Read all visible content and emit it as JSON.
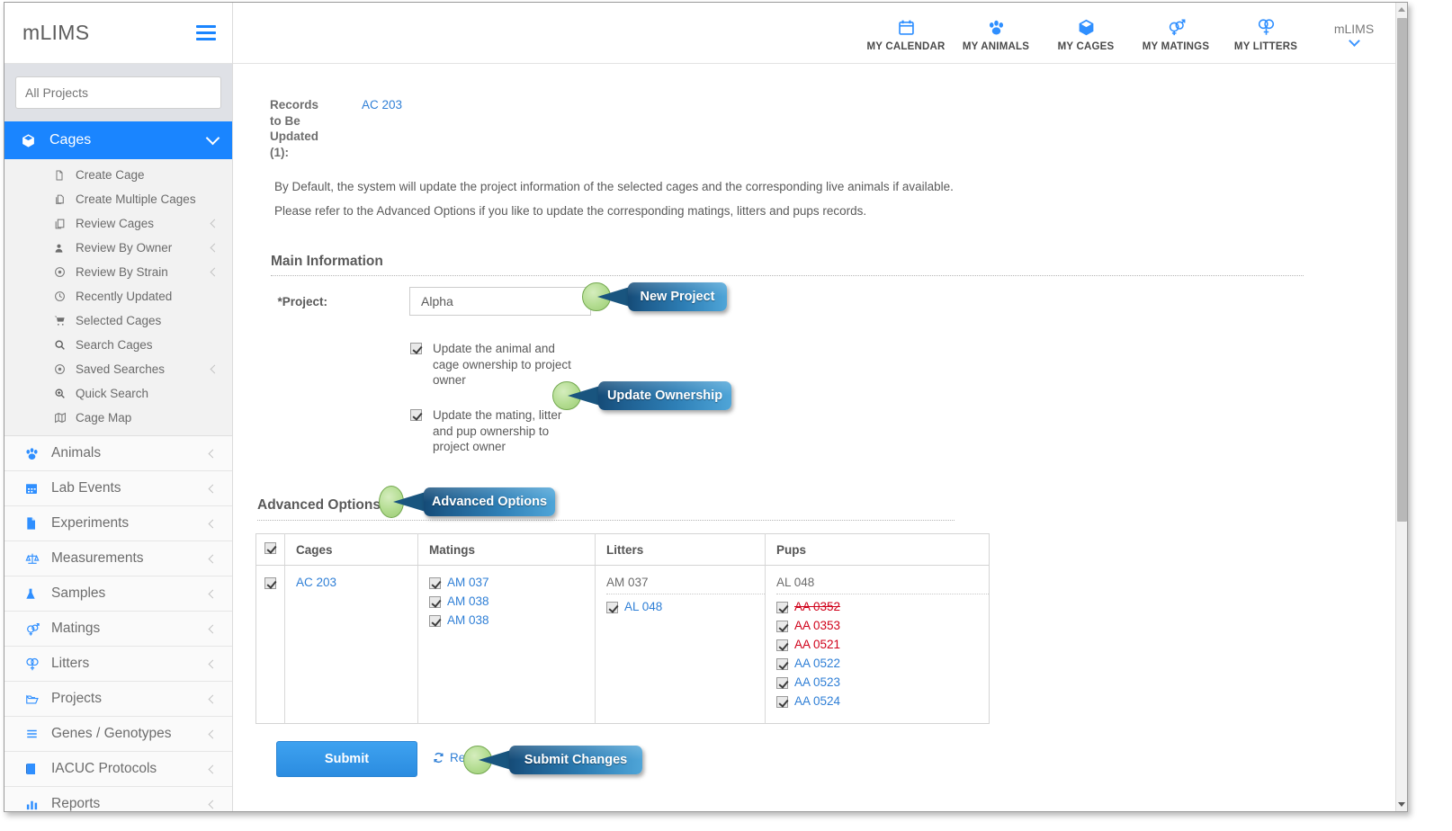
{
  "brand": {
    "name": "mLIMS",
    "menu_icon": "hamburger-icon"
  },
  "sidebar": {
    "project_filter_placeholder": "All Projects",
    "project_filter_value": "",
    "active_group": {
      "label": "Cages",
      "icon": "cube-icon",
      "expanded": true
    },
    "sub_items": [
      {
        "label": "Create Cage",
        "icon": "file-icon",
        "has_chevron": false
      },
      {
        "label": "Create Multiple Cages",
        "icon": "copy-files-icon",
        "has_chevron": false
      },
      {
        "label": "Review Cages",
        "icon": "copy-icon",
        "has_chevron": true
      },
      {
        "label": "Review By Owner",
        "icon": "user-icon",
        "has_chevron": true
      },
      {
        "label": "Review By Strain",
        "icon": "target-icon",
        "has_chevron": true
      },
      {
        "label": "Recently Updated",
        "icon": "clock-icon",
        "has_chevron": false
      },
      {
        "label": "Selected Cages",
        "icon": "cart-icon",
        "has_chevron": false
      },
      {
        "label": "Search Cages",
        "icon": "search-icon",
        "has_chevron": false
      },
      {
        "label": "Saved Searches",
        "icon": "target-icon",
        "has_chevron": true
      },
      {
        "label": "Quick Search",
        "icon": "search-plus-icon",
        "has_chevron": false
      },
      {
        "label": "Cage Map",
        "icon": "map-icon",
        "has_chevron": false
      }
    ],
    "main_items": [
      {
        "label": "Animals",
        "icon": "paw-icon"
      },
      {
        "label": "Lab Events",
        "icon": "calendar-icon"
      },
      {
        "label": "Experiments",
        "icon": "flask-doc-icon"
      },
      {
        "label": "Measurements",
        "icon": "scale-icon"
      },
      {
        "label": "Samples",
        "icon": "flask-icon"
      },
      {
        "label": "Matings",
        "icon": "male-female-icon"
      },
      {
        "label": "Litters",
        "icon": "double-female-icon"
      },
      {
        "label": "Projects",
        "icon": "folder-icon"
      },
      {
        "label": "Genes / Genotypes",
        "icon": "list-icon"
      },
      {
        "label": "IACUC Protocols",
        "icon": "book-icon"
      },
      {
        "label": "Reports",
        "icon": "chart-icon"
      }
    ]
  },
  "topnav": {
    "items": [
      {
        "label": "MY CALENDAR",
        "icon": "calendar-icon"
      },
      {
        "label": "MY ANIMALS",
        "icon": "paw-icon"
      },
      {
        "label": "MY CAGES",
        "icon": "cube-icon"
      },
      {
        "label": "MY MATINGS",
        "icon": "male-female-icon"
      },
      {
        "label": "MY LITTERS",
        "icon": "double-female-icon"
      }
    ],
    "user": {
      "name": "mLIMS",
      "caret": "chevron-down-icon"
    }
  },
  "page": {
    "records_heading": "Records to Be Updated (1):",
    "records_link": "AC 203",
    "description_line1": "By Default, the system will update the project information of the selected cages and the corresponding live animals if available.",
    "description_line2": "Please refer to the Advanced Options if you like to update the corresponding matings, litters and pups records."
  },
  "main_information": {
    "section_title": "Main Information",
    "project_label": "*Project:",
    "project_value": "Alpha",
    "checkboxes": [
      {
        "label": "Update the animal and cage ownership to project owner",
        "checked": true
      },
      {
        "label": "Update the mating, litter and pup ownership to project owner",
        "checked": true
      }
    ]
  },
  "advanced_options": {
    "section_title": "Advanced Options",
    "table": {
      "select_all_checked": true,
      "columns": [
        "",
        "Cages",
        "Matings",
        "Litters",
        "Pups"
      ],
      "row": {
        "row_checked": true,
        "cages": [
          {
            "text": "AC 203",
            "style": "link",
            "checkbox": false
          }
        ],
        "matings": [
          {
            "text": "AM 037",
            "style": "link",
            "checkbox": true,
            "checked": true
          },
          {
            "text": "AM 038",
            "style": "link",
            "checkbox": true,
            "checked": true
          },
          {
            "text": "AM 038",
            "style": "link",
            "checkbox": true,
            "checked": true
          }
        ],
        "litters": [
          {
            "text": "AM 037",
            "style": "plain-header",
            "checkbox": false
          },
          {
            "text": "AL 048",
            "style": "link",
            "checkbox": true,
            "checked": true
          }
        ],
        "pups": [
          {
            "text": "AL 048",
            "style": "plain-header",
            "checkbox": false
          },
          {
            "text": "AA 0352",
            "style": "red-strike",
            "checkbox": true,
            "checked": true
          },
          {
            "text": "AA 0353",
            "style": "red",
            "checkbox": true,
            "checked": true
          },
          {
            "text": "AA 0521",
            "style": "red",
            "checkbox": true,
            "checked": true
          },
          {
            "text": "AA 0522",
            "style": "link",
            "checkbox": true,
            "checked": true
          },
          {
            "text": "AA 0523",
            "style": "link",
            "checkbox": true,
            "checked": true
          },
          {
            "text": "AA 0524",
            "style": "link",
            "checkbox": true,
            "checked": true
          }
        ]
      }
    }
  },
  "actions": {
    "submit_label": "Submit",
    "reset_label": "Reset",
    "reset_icon": "refresh-icon"
  },
  "callouts": [
    {
      "label": "New Project"
    },
    {
      "label": "Update Ownership"
    },
    {
      "label": "Advanced Options"
    },
    {
      "label": "Submit Changes"
    }
  ],
  "colors": {
    "accent_blue": "#1a85ff",
    "link_blue": "#2f7fd6",
    "red": "#d0021b",
    "callout_dark": "#154b77",
    "callout_light": "#4fa5d8",
    "dot_green": "#b4dd92"
  }
}
